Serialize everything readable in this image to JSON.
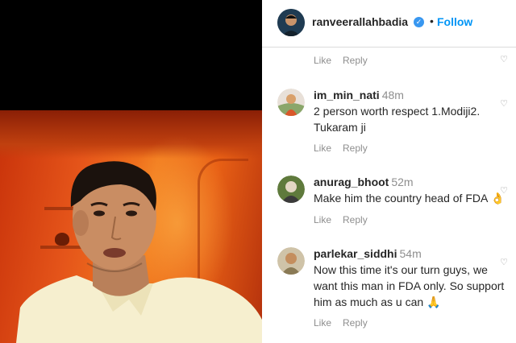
{
  "header": {
    "username": "ranveerallahbadia",
    "separator": "•",
    "follow_label": "Follow"
  },
  "first_actions": {
    "like": "Like",
    "reply": "Reply"
  },
  "comments": [
    {
      "username": "im_min_nati",
      "time": "48m",
      "text": "2 person worth respect 1.Modiji2. Tukaram ji",
      "like": "Like",
      "reply": "Reply"
    },
    {
      "username": "anurag_bhoot",
      "time": "52m",
      "text": "Make him the country head of FDA 👌",
      "like": "Like",
      "reply": "Reply"
    },
    {
      "username": "parlekar_siddhi",
      "time": "54m",
      "text": "Now this time it's our turn guys, we want this man in FDA only. So support him as much as u can 🙏",
      "like": "Like",
      "reply": "Reply"
    }
  ],
  "icons": {
    "verified": "verified-badge-icon",
    "heart": "heart-icon"
  }
}
